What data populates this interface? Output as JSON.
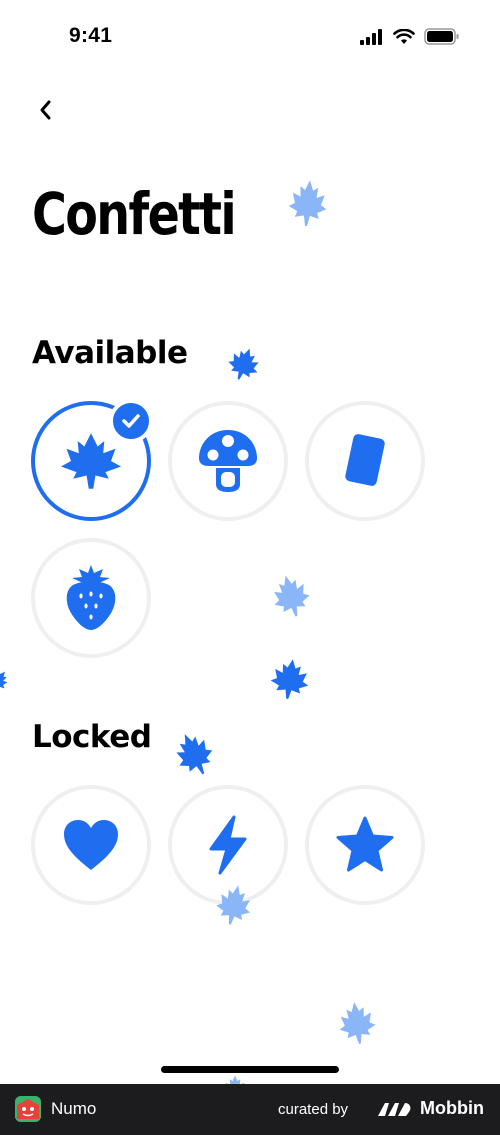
{
  "status_bar": {
    "time": "9:41"
  },
  "header": {
    "back_icon": "chevron-left-icon"
  },
  "page_title": "Confetti",
  "available": {
    "title": "Available",
    "items": [
      {
        "id": "maple-leaf",
        "icon": "maple-leaf-icon",
        "selected": true
      },
      {
        "id": "mushroom",
        "icon": "mushroom-icon",
        "selected": false
      },
      {
        "id": "card",
        "icon": "card-icon",
        "selected": false
      },
      {
        "id": "strawberry",
        "icon": "strawberry-icon",
        "selected": false
      }
    ]
  },
  "locked": {
    "title": "Locked",
    "items": [
      {
        "id": "heart",
        "icon": "heart-icon"
      },
      {
        "id": "lightning",
        "icon": "lightning-bolt-icon"
      },
      {
        "id": "star",
        "icon": "star-icon"
      }
    ]
  },
  "colors": {
    "accent": "#1f6ef0",
    "accent_light": "#8ab6f7",
    "ring": "#efefef"
  },
  "footer": {
    "app_name": "Numo",
    "curated_by": "curated by",
    "brand": "Mobbin"
  }
}
